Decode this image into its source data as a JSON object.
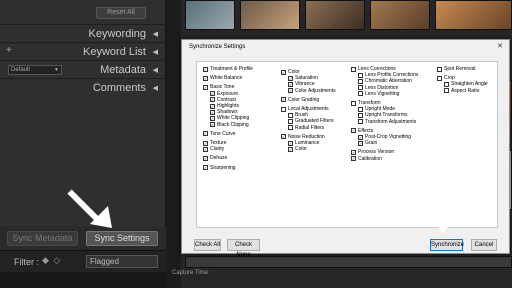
{
  "left_panel": {
    "reset_all": "Reset All",
    "headers": [
      {
        "label": "Keywording",
        "plus": false
      },
      {
        "label": "Keyword List",
        "plus": true
      },
      {
        "label": "Metadata",
        "plus": false,
        "preset": "Default"
      },
      {
        "label": "Comments",
        "plus": false
      }
    ],
    "sync_metadata": "Sync Metadata",
    "sync_settings": "Sync Settings",
    "filter_label": "Filter :",
    "filter_value": "Flagged"
  },
  "grid": {
    "capture_time": "Capture Time :"
  },
  "dialog": {
    "title": "Synchronize Settings",
    "close": "✕",
    "check_all": "Check All",
    "check_none": "Check None",
    "synchronize": "Synchronize",
    "cancel": "Cancel",
    "columns": [
      [
        {
          "label": "Treatment & Profile",
          "checked": true,
          "indent": 0
        },
        {
          "label": "",
          "gap": true
        },
        {
          "label": "White Balance",
          "checked": true,
          "indent": 0
        },
        {
          "label": "",
          "gap": true
        },
        {
          "label": "Basic Tone",
          "checked": true,
          "indent": 0
        },
        {
          "label": "Exposure",
          "checked": true,
          "indent": 1
        },
        {
          "label": "Contrast",
          "checked": true,
          "indent": 1
        },
        {
          "label": "Highlights",
          "checked": true,
          "indent": 1
        },
        {
          "label": "Shadows",
          "checked": true,
          "indent": 1
        },
        {
          "label": "White Clipping",
          "checked": true,
          "indent": 1
        },
        {
          "label": "Black Clipping",
          "checked": true,
          "indent": 1
        },
        {
          "label": "",
          "gap": true
        },
        {
          "label": "Tone Curve",
          "checked": true,
          "indent": 0
        },
        {
          "label": "",
          "gap": true
        },
        {
          "label": "Texture",
          "checked": true,
          "indent": 0
        },
        {
          "label": "Clarity",
          "checked": true,
          "indent": 0
        },
        {
          "label": "",
          "gap": true
        },
        {
          "label": "Dehaze",
          "checked": true,
          "indent": 0
        },
        {
          "label": "",
          "gap": true
        },
        {
          "label": "Sharpening",
          "checked": true,
          "indent": 0
        }
      ],
      [
        {
          "label": "",
          "gap": true
        },
        {
          "label": "Color",
          "checked": true,
          "indent": 0
        },
        {
          "label": "Saturation",
          "checked": true,
          "indent": 1
        },
        {
          "label": "Vibrance",
          "checked": true,
          "indent": 1
        },
        {
          "label": "Color Adjustments",
          "checked": true,
          "indent": 1
        },
        {
          "label": "",
          "gap": true
        },
        {
          "label": "Color Grading",
          "checked": true,
          "indent": 0
        },
        {
          "label": "",
          "gap": true
        },
        {
          "label": "Local Adjustments",
          "checked": false,
          "indent": 0
        },
        {
          "label": "Brush",
          "checked": false,
          "indent": 1
        },
        {
          "label": "Graduated Filters",
          "checked": false,
          "indent": 1
        },
        {
          "label": "Radial Filters",
          "checked": false,
          "indent": 1
        },
        {
          "label": "",
          "gap": true
        },
        {
          "label": "Noise Reduction",
          "checked": true,
          "indent": 0
        },
        {
          "label": "Luminance",
          "checked": true,
          "indent": 1
        },
        {
          "label": "Color",
          "checked": true,
          "indent": 1
        }
      ],
      [
        {
          "label": "Lens Corrections",
          "checked": false,
          "indent": 0
        },
        {
          "label": "Lens Profile Corrections",
          "checked": false,
          "indent": 1
        },
        {
          "label": "Chromatic Aberration",
          "checked": false,
          "indent": 1
        },
        {
          "label": "Lens Distortion",
          "checked": false,
          "indent": 1
        },
        {
          "label": "Lens Vignetting",
          "checked": false,
          "indent": 1
        },
        {
          "label": "",
          "gap": true
        },
        {
          "label": "Transform",
          "checked": false,
          "indent": 0
        },
        {
          "label": "Upright Mode",
          "checked": false,
          "indent": 1
        },
        {
          "label": "Upright Transforms",
          "checked": false,
          "indent": 1
        },
        {
          "label": "Transform Adjustments",
          "checked": false,
          "indent": 1
        },
        {
          "label": "",
          "gap": true
        },
        {
          "label": "Effects",
          "checked": true,
          "indent": 0
        },
        {
          "label": "Post-Crop Vignetting",
          "checked": true,
          "indent": 1
        },
        {
          "label": "Grain",
          "checked": true,
          "indent": 1
        },
        {
          "label": "",
          "gap": true
        },
        {
          "label": "Process Version",
          "checked": true,
          "indent": 0
        },
        {
          "label": "Calibration",
          "checked": true,
          "indent": 0
        }
      ],
      [
        {
          "label": "Spot Removal",
          "checked": false,
          "indent": 0
        },
        {
          "label": "",
          "gap": true
        },
        {
          "label": "Crop",
          "checked": false,
          "indent": 0
        },
        {
          "label": "Straighten Angle",
          "checked": false,
          "indent": 1
        },
        {
          "label": "Aspect Ratio",
          "checked": false,
          "indent": 1
        }
      ]
    ]
  },
  "colors": {
    "panel_bg": "#2f2f2f",
    "dialog_bg": "#f0f0f0",
    "accent_focus": "#0078d7"
  }
}
